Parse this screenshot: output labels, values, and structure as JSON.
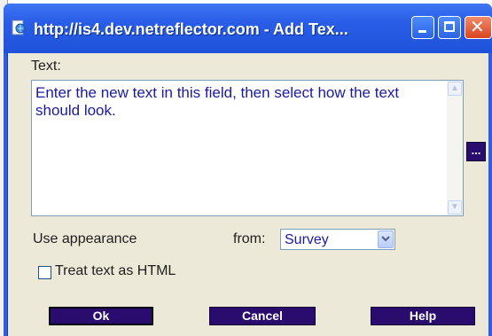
{
  "window": {
    "title": "http://is4.dev.netreflector.com - Add Tex...",
    "accent": "#2a5ee8"
  },
  "form": {
    "text_label": "Text:",
    "textarea_value": "Enter the new text in this field, then select how the text should look.",
    "more_button": "...",
    "appearance_label": "Use appearance",
    "from_label": "from:",
    "appearance_selected": "Survey",
    "treat_html_label": "Treat text as HTML",
    "treat_html_checked": false
  },
  "buttons": {
    "ok": "Ok",
    "cancel": "Cancel",
    "help": "Help",
    "color": "#2a0b6e"
  },
  "icons": [
    "browser-page-icon",
    "minimize-icon",
    "maximize-icon",
    "close-icon",
    "scroll-up-icon",
    "scroll-down-icon",
    "chevron-down-icon"
  ]
}
